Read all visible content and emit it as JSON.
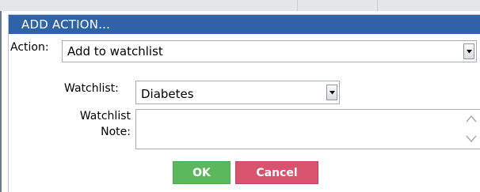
{
  "dialog": {
    "title": "ADD ACTION..."
  },
  "action": {
    "label": "Action:",
    "value": "Add to watchlist"
  },
  "watchlist": {
    "label": "Watchlist:",
    "value": "Diabetes"
  },
  "note": {
    "label_line1": "Watchlist",
    "label_line2": "Note:",
    "value": ""
  },
  "buttons": {
    "ok_label": "OK",
    "cancel_label": "Cancel"
  },
  "icons": {
    "dropdown": "chevron-down-icon",
    "scroll_up": "chevron-up-icon",
    "scroll_down": "chevron-down-icon"
  },
  "colors": {
    "titlebar": "#2f63a8",
    "ok": "#5cb85c",
    "cancel": "#d9536f"
  }
}
